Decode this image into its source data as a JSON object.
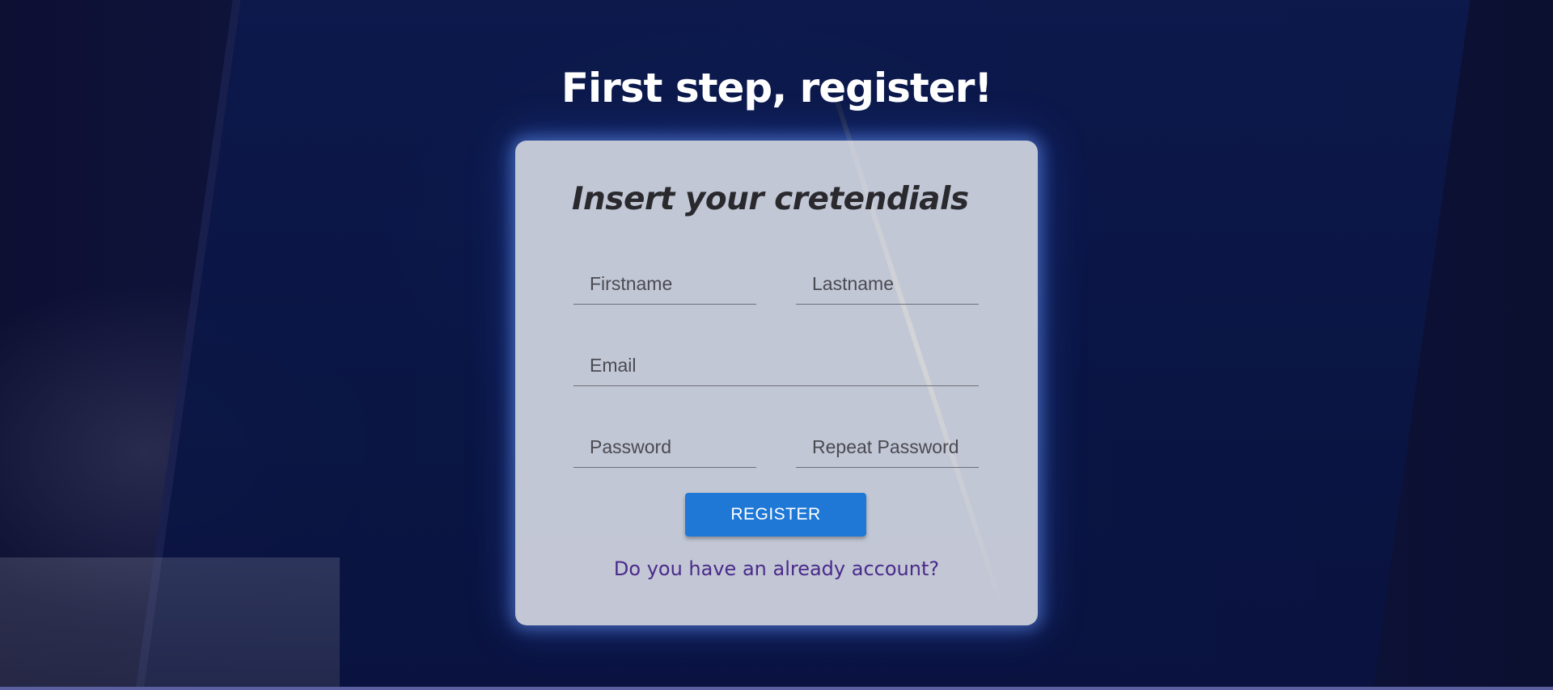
{
  "page": {
    "title": "First step, register!"
  },
  "form": {
    "heading": "Insert your cretendials",
    "fields": {
      "firstname": {
        "placeholder": "Firstname",
        "value": ""
      },
      "lastname": {
        "placeholder": "Lastname",
        "value": ""
      },
      "email": {
        "placeholder": "Email",
        "value": ""
      },
      "password": {
        "placeholder": "Password",
        "value": ""
      },
      "repeat_password": {
        "placeholder": "Repeat Password",
        "value": ""
      }
    },
    "submit_label": "REGISTER",
    "login_link_label": "Do you have an already account?"
  },
  "colors": {
    "button": "#1f78d6",
    "link": "#4a2a8a",
    "card_background": "#e1e4ee",
    "page_background": "#0b0f33"
  }
}
